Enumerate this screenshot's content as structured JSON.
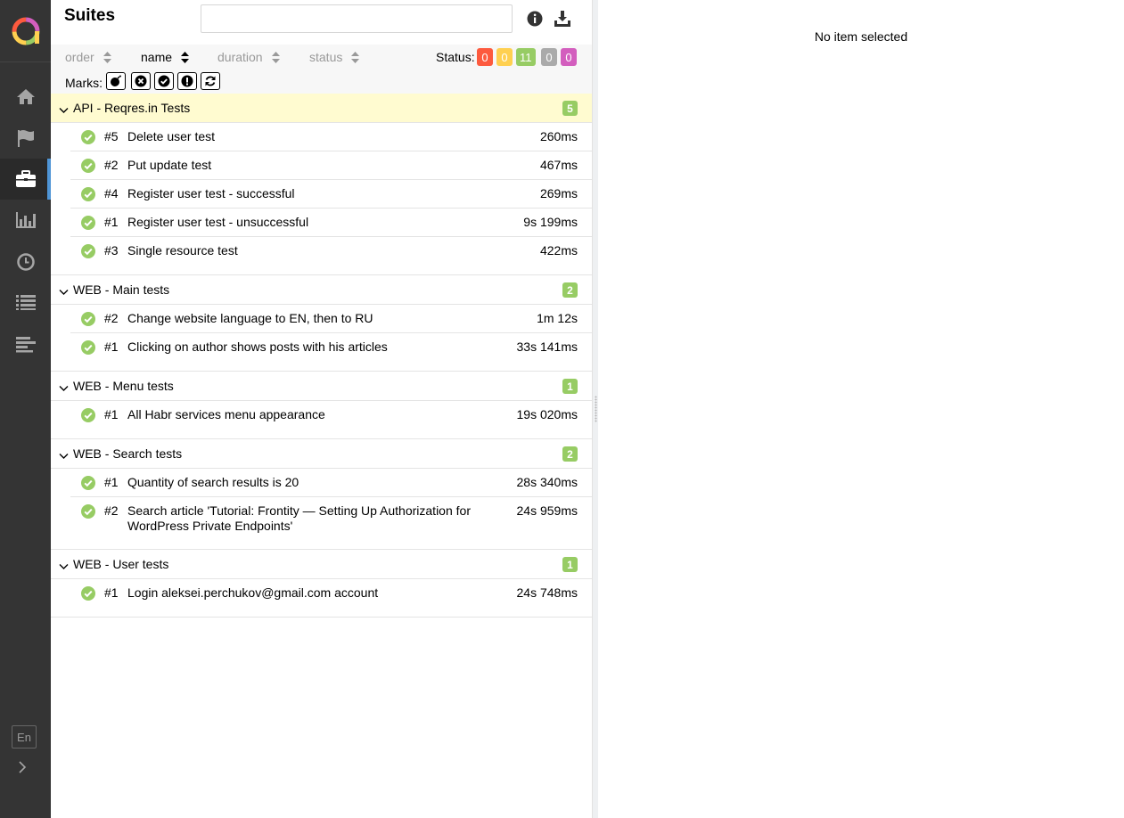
{
  "app": {
    "colors": {
      "sidebar_bg": "#343434",
      "accent": "#4f95d6",
      "passed": "#97cc64",
      "failed": "#fd5a3e",
      "broken": "#ffd050",
      "skipped": "#aaaaaa",
      "unknown": "#d35ebe"
    }
  },
  "sidebar": {
    "items": [
      {
        "icon": "home-icon"
      },
      {
        "icon": "flag-icon"
      },
      {
        "icon": "briefcase-icon",
        "active": true
      },
      {
        "icon": "bar-chart-icon"
      },
      {
        "icon": "clock-icon"
      },
      {
        "icon": "list-icon"
      },
      {
        "icon": "timeline-icon"
      }
    ],
    "language": "En"
  },
  "tree": {
    "title": "Suites",
    "search": {
      "value": "",
      "placeholder": ""
    },
    "sort": {
      "order": "order",
      "name": "name",
      "duration": "duration",
      "status": "status",
      "active": "name"
    },
    "status": {
      "label": "Status:",
      "counts": {
        "failed": "0",
        "broken": "0",
        "passed": "11",
        "skipped": "0",
        "unknown": "0"
      }
    },
    "marks_label": "Marks:",
    "groups": [
      {
        "name": "API - Reqres.in Tests",
        "count": "5",
        "highlighted": true,
        "tests": [
          {
            "num": "#5",
            "name": "Delete user test",
            "duration": "260ms"
          },
          {
            "num": "#2",
            "name": "Put update test",
            "duration": "467ms"
          },
          {
            "num": "#4",
            "name": "Register user test - successful",
            "duration": "269ms"
          },
          {
            "num": "#1",
            "name": "Register user test - unsuccessful",
            "duration": "9s 199ms"
          },
          {
            "num": "#3",
            "name": "Single resource test",
            "duration": "422ms"
          }
        ]
      },
      {
        "name": "WEB - Main tests",
        "count": "2",
        "tests": [
          {
            "num": "#2",
            "name": "Change website language to EN, then to RU",
            "duration": "1m 12s"
          },
          {
            "num": "#1",
            "name": "Clicking on author shows posts with his articles",
            "duration": "33s 141ms"
          }
        ]
      },
      {
        "name": "WEB - Menu tests",
        "count": "1",
        "tests": [
          {
            "num": "#1",
            "name": "All Habr services menu appearance",
            "duration": "19s 020ms"
          }
        ]
      },
      {
        "name": "WEB - Search tests",
        "count": "2",
        "tests": [
          {
            "num": "#1",
            "name": "Quantity of search results is 20",
            "duration": "28s 340ms"
          },
          {
            "num": "#2",
            "name": "Search article 'Tutorial: Frontity — Setting Up Authorization for WordPress Private Endpoints'",
            "duration": "24s 959ms"
          }
        ]
      },
      {
        "name": "WEB - User tests",
        "count": "1",
        "tests": [
          {
            "num": "#1",
            "name": "Login aleksei.perchukov@gmail.com account",
            "duration": "24s 748ms"
          }
        ]
      }
    ]
  },
  "detail": {
    "empty_message": "No item selected"
  }
}
